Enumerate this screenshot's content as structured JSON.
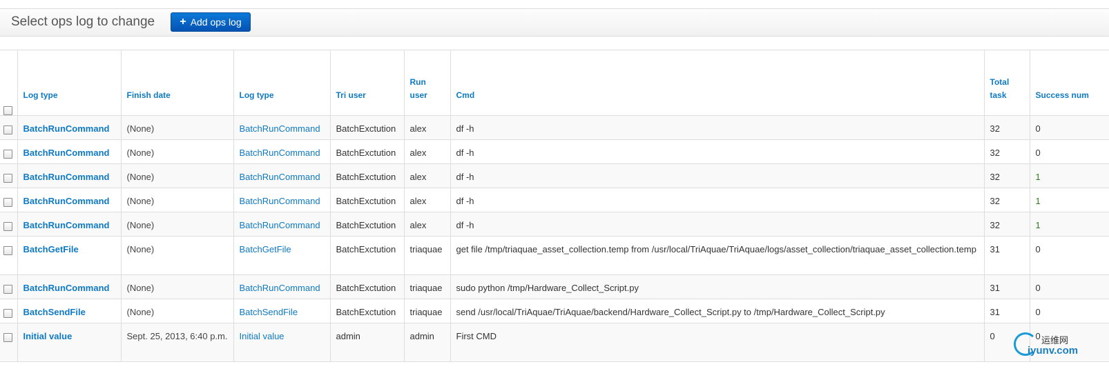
{
  "header": {
    "title": "Select ops log to change",
    "add_button_label": "Add ops log",
    "add_button_icon": "plus-icon"
  },
  "table": {
    "columns": [
      "Log type",
      "Finish date",
      "Log type",
      "Tri user",
      "Run user",
      "Cmd",
      "Total task",
      "Success num"
    ],
    "rows": [
      {
        "log_type": "BatchRunCommand",
        "finish_date": "(None)",
        "log_type2": "BatchRunCommand",
        "tri_user": "BatchExctution",
        "run_user": "alex",
        "cmd": "df -h",
        "total_task": "32",
        "success_num": "0",
        "success_highlight": false
      },
      {
        "log_type": "BatchRunCommand",
        "finish_date": "(None)",
        "log_type2": "BatchRunCommand",
        "tri_user": "BatchExctution",
        "run_user": "alex",
        "cmd": "df -h",
        "total_task": "32",
        "success_num": "0",
        "success_highlight": false
      },
      {
        "log_type": "BatchRunCommand",
        "finish_date": "(None)",
        "log_type2": "BatchRunCommand",
        "tri_user": "BatchExctution",
        "run_user": "alex",
        "cmd": "df -h",
        "total_task": "32",
        "success_num": "1",
        "success_highlight": true
      },
      {
        "log_type": "BatchRunCommand",
        "finish_date": "(None)",
        "log_type2": "BatchRunCommand",
        "tri_user": "BatchExctution",
        "run_user": "alex",
        "cmd": "df -h",
        "total_task": "32",
        "success_num": "1",
        "success_highlight": true
      },
      {
        "log_type": "BatchRunCommand",
        "finish_date": "(None)",
        "log_type2": "BatchRunCommand",
        "tri_user": "BatchExctution",
        "run_user": "alex",
        "cmd": "df -h",
        "total_task": "32",
        "success_num": "1",
        "success_highlight": true
      },
      {
        "log_type": "BatchGetFile",
        "finish_date": "(None)",
        "log_type2": "BatchGetFile",
        "tri_user": "BatchExctution",
        "run_user": "triaquae",
        "cmd": "get file /tmp/triaquae_asset_collection.temp from /usr/local/TriAquae/TriAquae/logs/asset_collection/triaquae_asset_collection.temp",
        "total_task": "31",
        "success_num": "0",
        "success_highlight": false
      },
      {
        "log_type": "BatchRunCommand",
        "finish_date": "(None)",
        "log_type2": "BatchRunCommand",
        "tri_user": "BatchExctution",
        "run_user": "triaquae",
        "cmd": "sudo python /tmp/Hardware_Collect_Script.py",
        "total_task": "31",
        "success_num": "0",
        "success_highlight": false
      },
      {
        "log_type": "BatchSendFile",
        "finish_date": "(None)",
        "log_type2": "BatchSendFile",
        "tri_user": "BatchExctution",
        "run_user": "triaquae",
        "cmd": "send /usr/local/TriAquae/TriAquae/backend/Hardware_Collect_Script.py to /tmp/Hardware_Collect_Script.py",
        "total_task": "31",
        "success_num": "0",
        "success_highlight": false
      },
      {
        "log_type": "Initial value",
        "finish_date": "Sept. 25, 2013, 6:40 p.m.",
        "log_type2": "Initial value",
        "tri_user": "admin",
        "run_user": "admin",
        "cmd": "First CMD",
        "total_task": "0",
        "success_num": "0",
        "success_highlight": false
      }
    ]
  },
  "watermark": {
    "cn": "运维网",
    "en": "iyunv.com"
  },
  "colors": {
    "link": "#0e7ac4",
    "button": "#0553b3",
    "highlight": "#2f7d1b"
  }
}
